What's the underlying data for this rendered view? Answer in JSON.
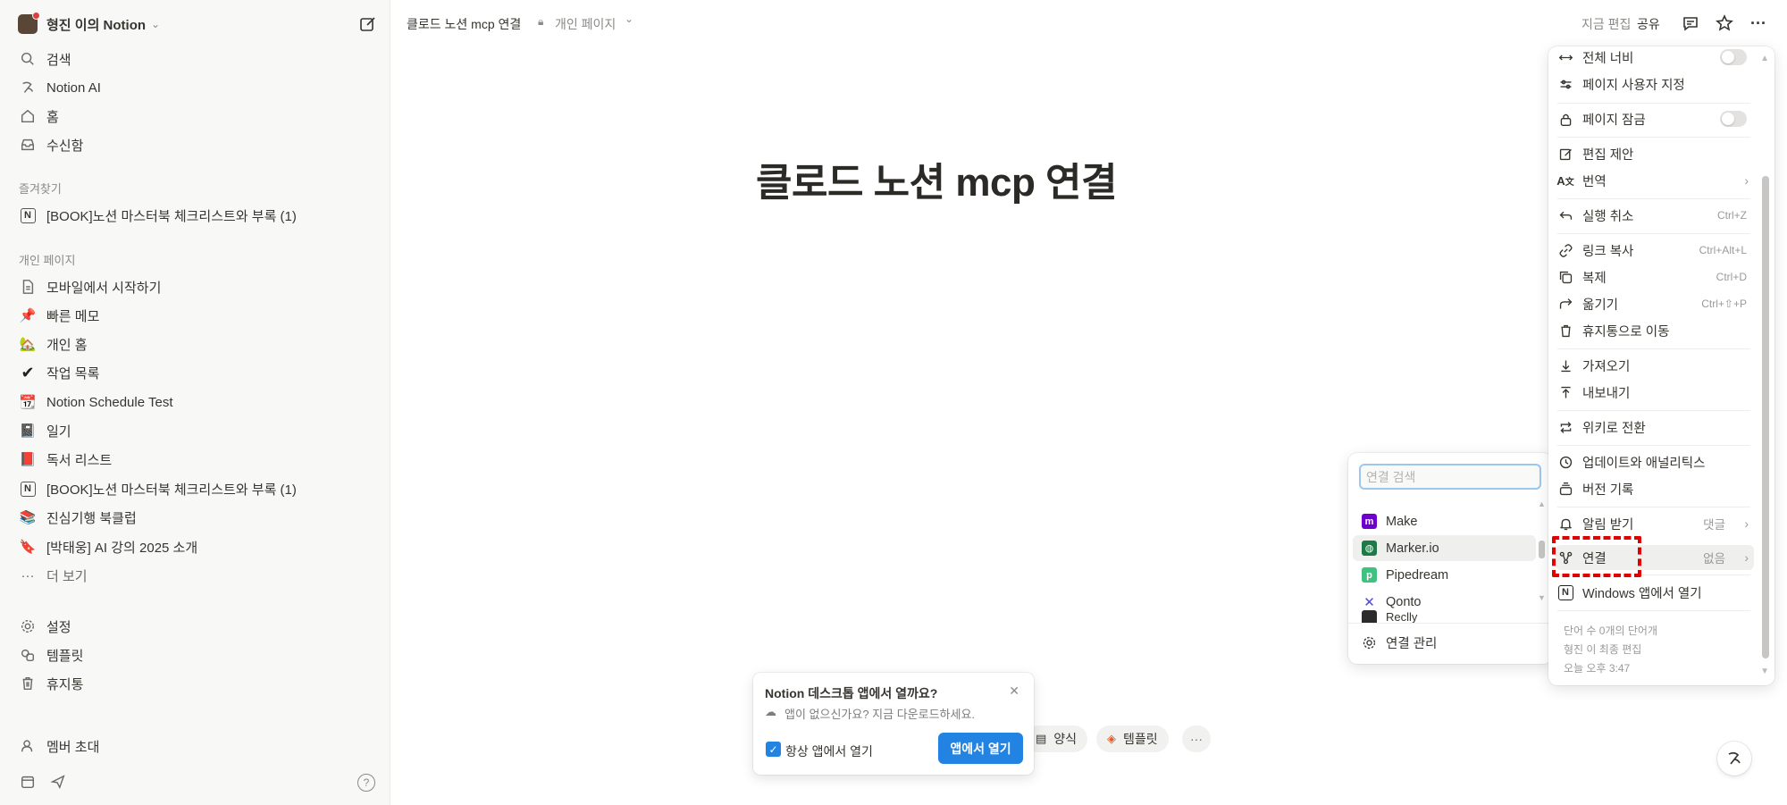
{
  "sidebar": {
    "workspace": "형진 이의 Notion",
    "nav": [
      "검색",
      "Notion AI",
      "홈",
      "수신함"
    ],
    "favorites_label": "즐겨찾기",
    "favorites": [
      "[BOOK]노션 마스터북 체크리스트와 부록 (1)"
    ],
    "private_label": "개인 페이지",
    "private": [
      "모바일에서 시작하기",
      "빠른 메모",
      "개인 홈",
      "작업 목록",
      "Notion Schedule Test",
      "일기",
      "독서 리스트",
      "[BOOK]노션 마스터북 체크리스트와 부록 (1)",
      "진심기행 북클럽",
      "[박태웅] AI 강의 2025 소개"
    ],
    "more": "더 보기",
    "bottom": [
      "설정",
      "템플릿",
      "휴지통"
    ],
    "invite": "멤버 초대"
  },
  "topbar": {
    "title": "클로드 노션 mcp 연결",
    "scope": "개인 페이지",
    "edited": "지금 편집",
    "share": "공유"
  },
  "page": {
    "title": "클로드 노션 mcp 연결"
  },
  "menu": {
    "full_width": "전체 너비",
    "customize": "페이지 사용자 지정",
    "lock": "페이지 잠금",
    "suggest": "편집 제안",
    "translate": "번역",
    "undo": "실행 취소",
    "undo_key": "Ctrl+Z",
    "copy_link": "링크 복사",
    "copy_link_key": "Ctrl+Alt+L",
    "duplicate": "복제",
    "duplicate_key": "Ctrl+D",
    "move": "옮기기",
    "move_key": "Ctrl+⇧+P",
    "trash": "휴지통으로 이동",
    "import": "가져오기",
    "export": "내보내기",
    "wiki": "위키로 전환",
    "updates": "업데이트와 애널리틱스",
    "history": "버전 기록",
    "notify": "알림 받기",
    "notify_val": "댓글",
    "connect": "연결",
    "connect_val": "없음",
    "open_windows": "Windows 앱에서 열기",
    "foot_words": "단어 수 0개의 단어개",
    "foot_editor": "형진 이 최종 편집",
    "foot_time": "오늘 오후 3:47"
  },
  "connections": {
    "search_placeholder": "연결 검색",
    "items": [
      {
        "name": "Make",
        "color": "#6d00cc"
      },
      {
        "name": "Marker.io",
        "color": "#1d7a46"
      },
      {
        "name": "Pipedream",
        "color": "#3ec27f"
      },
      {
        "name": "Qonto",
        "color": "#4a4ae0"
      },
      {
        "name": "Reclly",
        "color": "#2b2b2b"
      }
    ],
    "manage": "연결 관리"
  },
  "popup": {
    "title": "Notion 데스크톱 앱에서 열까요?",
    "subtitle": "앱이 없으신가요? 지금 다운로드하세요.",
    "checkbox": "항상 앱에서 열기",
    "button": "앱에서 열기"
  },
  "chips": {
    "form": "양식",
    "template": "템플릿"
  },
  "colors": {
    "accent": "#2383e2",
    "highlight": "#e00000"
  }
}
